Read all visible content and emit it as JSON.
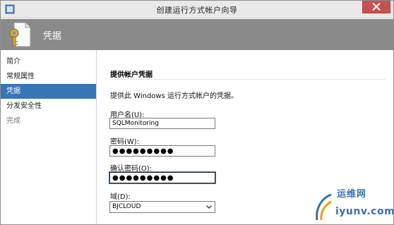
{
  "window": {
    "title": "创建运行方式帐户向导"
  },
  "banner": {
    "title": "凭据"
  },
  "sidebar": {
    "items": [
      {
        "label": "简介",
        "state": "done"
      },
      {
        "label": "常规属性",
        "state": "done"
      },
      {
        "label": "凭据",
        "state": "active"
      },
      {
        "label": "分发安全性",
        "state": "done"
      },
      {
        "label": "完成",
        "state": "pending"
      }
    ]
  },
  "content": {
    "section_title": "提供帐户凭据",
    "description": "提供此 Windows 运行方式帐户的凭据。",
    "username_label": "用户名(U):",
    "username_value": "SQLMonitoring",
    "password_label": "密码(W):",
    "password_value": "●●●●●●●●●",
    "confirm_label": "确认密码(O):",
    "confirm_value": "●●●●●●●●●",
    "domain_label": "域(D):",
    "domain_value": "BJCLOUD"
  },
  "watermark": {
    "top": "运维网",
    "bottom": "iyunv.com"
  },
  "colors": {
    "active_nav": "#3874b8",
    "banner": "#8a8a8a",
    "close_button": "#c75050",
    "watermark": "#3a6fb3"
  }
}
